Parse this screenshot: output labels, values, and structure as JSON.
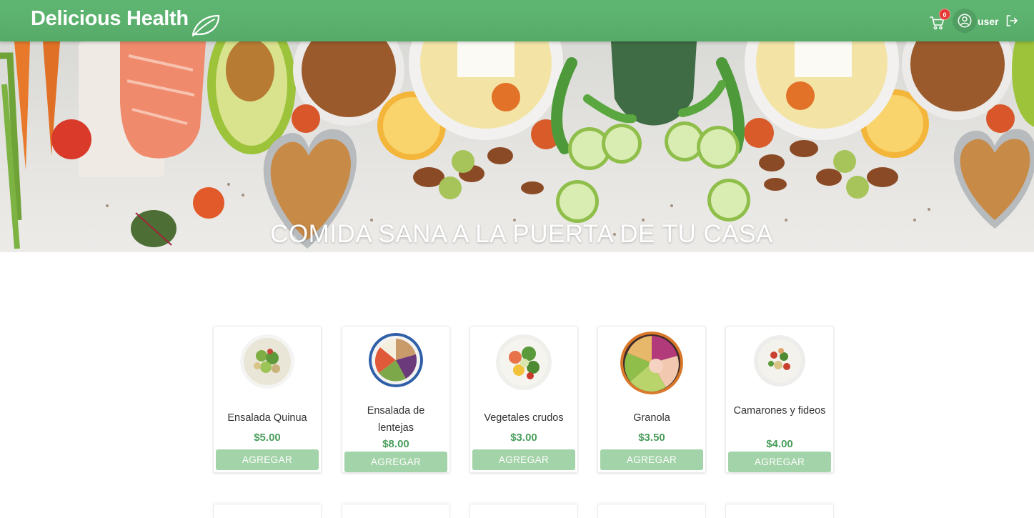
{
  "header": {
    "brand": "Delicious Health",
    "cart_count": "0",
    "user_label": "user",
    "icons": [
      "leaf-icon",
      "cart-icon",
      "user-circle-icon",
      "logout-icon"
    ]
  },
  "hero": {
    "title": "COMIDA SANA A LA PUERTA DE TU CASA"
  },
  "products": [
    {
      "name": "Ensalada Quinua",
      "price": "$5.00",
      "button": "AGREGAR"
    },
    {
      "name": "Ensalada de lentejas",
      "price": "$8.00",
      "button": "AGREGAR"
    },
    {
      "name": "Vegetales crudos",
      "price": "$3.00",
      "button": "AGREGAR"
    },
    {
      "name": "Granola",
      "price": "$3.50",
      "button": "AGREGAR"
    },
    {
      "name": "Camarones y fideos",
      "price": "$4.00",
      "button": "AGREGAR"
    }
  ],
  "colors": {
    "header_green": "#5fb672",
    "price_green": "#4a9e5c",
    "button_green": "#a3d3a8",
    "badge_red": "#e53935"
  }
}
